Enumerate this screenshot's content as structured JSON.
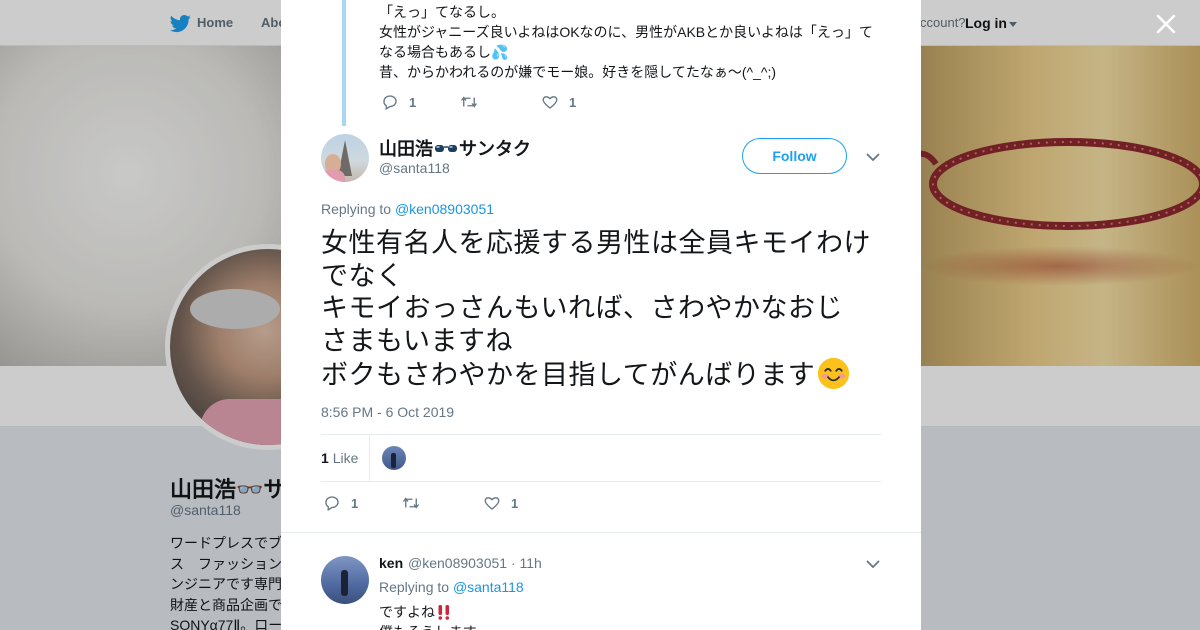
{
  "nav": {
    "home_label": "Home",
    "about_label": "Abo",
    "account_text": "ccount?",
    "login_label": "Log in"
  },
  "background_profile": {
    "name": "山田浩👓サ",
    "handle": "@santa118",
    "bio_lines": [
      "ワードプレスでブ",
      "ス　ファッション",
      "ンジニアです専門",
      "財産と商品企画で",
      "SONYα77Ⅱ。ロー"
    ]
  },
  "parent_tweet": {
    "lines": [
      "「えっ」てなるし。",
      "女性がジャニーズ良いよねはOKなのに、男性がAKBとか良いよねは「えっ」て",
      "なる場合もあるし💦",
      "昔、からかわれるのが嫌でモー娘。好きを隠してたなぁ～(^_^;)"
    ],
    "reply_count": "1",
    "like_count": "1"
  },
  "tweet": {
    "name_before": "山田浩",
    "name_after": "サンタク",
    "handle": "@santa118",
    "follow_label": "Follow",
    "replying_prefix": "Replying to",
    "replying_to": "@ken08903051",
    "text_lines": [
      "女性有名人を応援する男性は全員キモイわけ",
      "でなく",
      "キモイおっさんもいれば、さわやかなおじ",
      "さまもいますね",
      "ボクもさわやかを目指してがんばります"
    ],
    "timestamp": "8:56 PM - 6 Oct 2019",
    "likes_count": "1",
    "likes_label": "Like",
    "reply_count": "1",
    "like_count": "1"
  },
  "reply": {
    "name": "ken",
    "handle_time": "@ken08903051 · 11h",
    "replying_prefix": "Replying to",
    "replying_to": "@santa118",
    "line1": "ですよね",
    "line2": "僕もそうします"
  },
  "icons": {
    "close": "close-icon",
    "reply": "reply-icon",
    "retweet": "retweet-icon",
    "like": "heart-icon",
    "caret": "chevron-down-icon",
    "bird": "twitter-bird-icon"
  },
  "colors": {
    "accent": "#1da1f2",
    "link": "#1b95e0",
    "muted": "#657786",
    "thread_line": "#a9d6f3"
  }
}
